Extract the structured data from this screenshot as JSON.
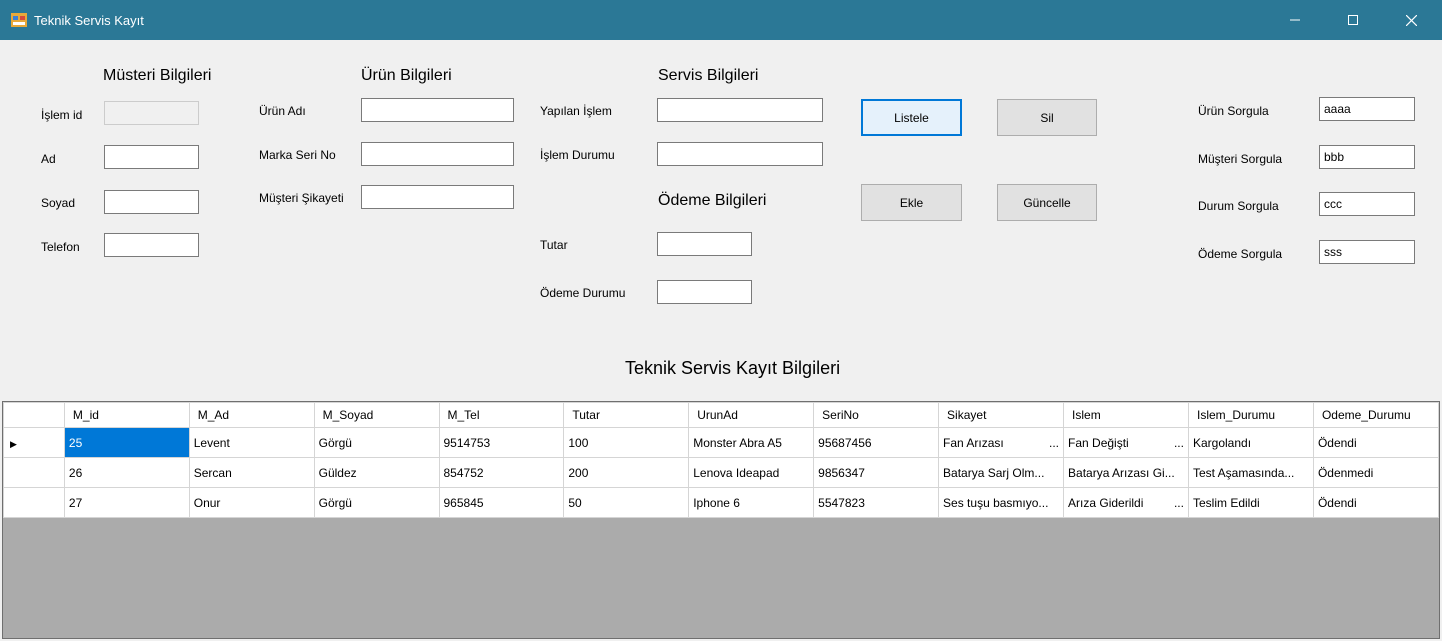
{
  "window": {
    "title": "Teknik Servis Kayıt",
    "icon": "windows-form-icon",
    "controls": [
      "minimize-icon",
      "maximize-icon",
      "close-icon"
    ]
  },
  "sections": {
    "customer": "Müsteri Bilgileri",
    "product": "Ürün Bilgileri",
    "service": "Servis Bilgileri",
    "payment": "Ödeme Bilgileri",
    "grid_title": "Teknik Servis Kayıt Bilgileri"
  },
  "customer": {
    "islem_id_label": "İşlem id",
    "ad_label": "Ad",
    "soyad_label": "Soyad",
    "telefon_label": "Telefon",
    "islem_id_value": "",
    "ad_value": "",
    "soyad_value": "",
    "telefon_value": ""
  },
  "product": {
    "urun_adi_label": "Ürün Adı",
    "marka_seri_label": "Marka Seri No",
    "sikayet_label": "Müşteri Şikayeti",
    "urun_adi_value": "",
    "marka_seri_value": "",
    "sikayet_value": ""
  },
  "service": {
    "yapilan_islem_label": "Yapılan İşlem",
    "islem_durumu_label": "İşlem Durumu",
    "yapilan_islem_value": "",
    "islem_durumu_value": ""
  },
  "payment": {
    "tutar_label": "Tutar",
    "odeme_durumu_label": "Ödeme Durumu",
    "tutar_value": "",
    "odeme_durumu_value": ""
  },
  "buttons": {
    "listele": "Listele",
    "sil": "Sil",
    "ekle": "Ekle",
    "guncelle": "Güncelle"
  },
  "queries": {
    "urun_label": "Ürün Sorgula",
    "musteri_label": "Müşteri Sorgula",
    "durum_label": "Durum Sorgula",
    "odeme_label": "Ödeme Sorgula",
    "urun_value": "aaaa",
    "musteri_value": "bbb",
    "durum_value": "ccc",
    "odeme_value": "sss"
  },
  "grid": {
    "columns": [
      "M_id",
      "M_Ad",
      "M_Soyad",
      "M_Tel",
      "Tutar",
      "UrunAd",
      "SeriNo",
      "Sikayet",
      "Islem",
      "Islem_Durumu",
      "Odeme_Durumu"
    ],
    "rows": [
      [
        "25",
        "Levent",
        "Görgü",
        "9514753",
        "100",
        "Monster Abra A5",
        "95687456",
        "Fan Arızası",
        "Fan Değişti",
        "Kargolandı",
        "Ödendi"
      ],
      [
        "26",
        "Sercan",
        "Güldez",
        "854752",
        "200",
        "Lenova Ideapad",
        "9856347",
        "Batarya Sarj Olm...",
        "Batarya Arızası Gi...",
        "Test Aşamasında...",
        "Ödenmedi"
      ],
      [
        "27",
        "Onur",
        "Görgü",
        "965845",
        "50",
        "Iphone 6",
        "5547823",
        "Ses tuşu basmıyo...",
        "Arıza Giderildi",
        "Teslim Edildi",
        "Ödendi"
      ]
    ],
    "current_row_marker": "▶",
    "ellipsis": "..."
  }
}
